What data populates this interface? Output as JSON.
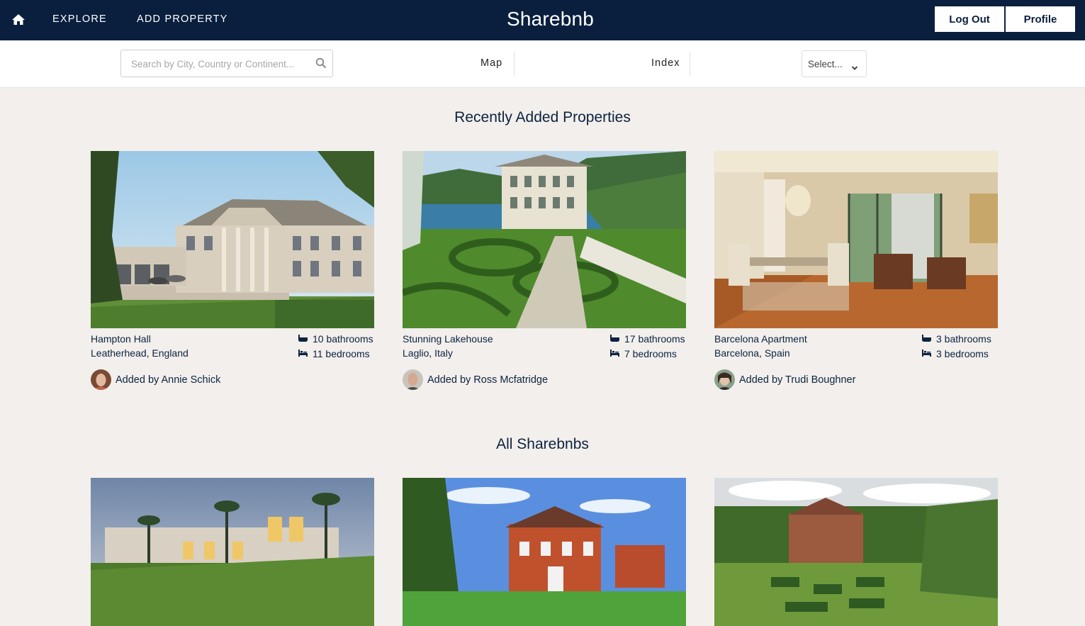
{
  "nav": {
    "home_icon": "home-icon",
    "explore_label": "EXPLORE",
    "add_label": "ADD PROPERTY",
    "brand": "Sharebnb",
    "logout_label": "Log Out",
    "profile_label": "Profile"
  },
  "filters": {
    "search_placeholder": "Search by City, Country or Continent...",
    "search_value": "",
    "map_label": "Map",
    "index_label": "Index",
    "select_value": "Select..."
  },
  "recent": {
    "title": "Recently Added Properties",
    "cards": [
      {
        "name": "Hampton Hall",
        "location": "Leatherhead, England",
        "bathrooms": "10 bathrooms",
        "bedrooms": "11 bedrooms",
        "added_by": "Added by Annie Schick"
      },
      {
        "name": "Stunning Lakehouse",
        "location": "Laglio, Italy",
        "bathrooms": "17 bathrooms",
        "bedrooms": "7 bedrooms",
        "added_by": "Added by Ross Mcfatridge"
      },
      {
        "name": "Barcelona Apartment",
        "location": "Barcelona, Spain",
        "bathrooms": "3 bathrooms",
        "bedrooms": "3 bedrooms",
        "added_by": "Added by Trudi Boughner"
      }
    ]
  },
  "all": {
    "title": "All Sharebnbs"
  },
  "colors": {
    "navy": "#0a1f3e",
    "background": "#f2efec"
  }
}
